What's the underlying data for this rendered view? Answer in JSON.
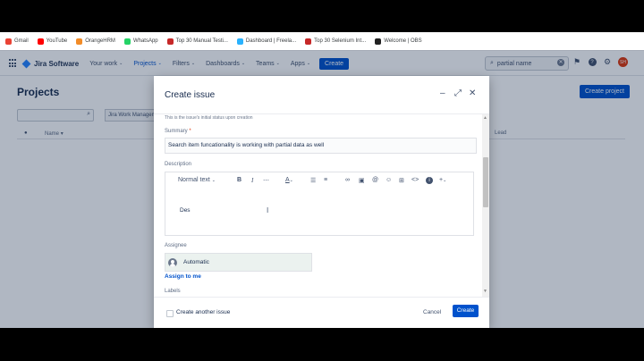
{
  "bookmarks": [
    {
      "label": "Gmail",
      "icon": "gmail-icon",
      "color": "#ea4335"
    },
    {
      "label": "YouTube",
      "icon": "youtube-icon",
      "color": "#ff0000"
    },
    {
      "label": "OrangeHRM",
      "icon": "orangehrm-icon",
      "color": "#f28c28"
    },
    {
      "label": "WhatsApp",
      "icon": "whatsapp-icon",
      "color": "#25d366"
    },
    {
      "label": "Top 30 Manual Testi...",
      "icon": "bookmark-red-icon",
      "color": "#c62828"
    },
    {
      "label": "Dashboard | Freela...",
      "icon": "freelancer-icon",
      "color": "#29b2fe"
    },
    {
      "label": "Top 30 Selenium Int...",
      "icon": "bookmark-red-icon",
      "color": "#c62828"
    },
    {
      "label": "Welcome | OBS",
      "icon": "obs-icon",
      "color": "#222222"
    }
  ],
  "jira": {
    "product": "Jira Software",
    "nav": [
      {
        "label": "Your work",
        "active": false
      },
      {
        "label": "Projects",
        "active": true
      },
      {
        "label": "Filters",
        "active": false
      },
      {
        "label": "Dashboards",
        "active": false
      },
      {
        "label": "Teams",
        "active": false
      },
      {
        "label": "Apps",
        "active": false
      }
    ],
    "create_label": "Create",
    "search_value": "partial name",
    "avatar_initials": "SH"
  },
  "page": {
    "title": "Projects",
    "create_project": "Create project",
    "filter_value": "Jira Work Managem...",
    "col_name": "Name",
    "col_lead": "Lead"
  },
  "modal": {
    "title": "Create issue",
    "hint": "This is the issue's initial status upon creation",
    "summary_label": "Summary",
    "summary_required": "*",
    "summary_value": "Search item funcationality is working with partial data as well",
    "description_label": "Description",
    "text_style": "Normal text",
    "description_value": "Des",
    "assignee_label": "Assignee",
    "assignee_value": "Automatic",
    "assign_to_me": "Assign to me",
    "labels_label": "Labels",
    "create_another": "Create another issue",
    "cancel": "Cancel",
    "create": "Create"
  },
  "colors": {
    "primary": "#0052cc",
    "text": "#172b4d",
    "muted": "#5e6c84"
  }
}
